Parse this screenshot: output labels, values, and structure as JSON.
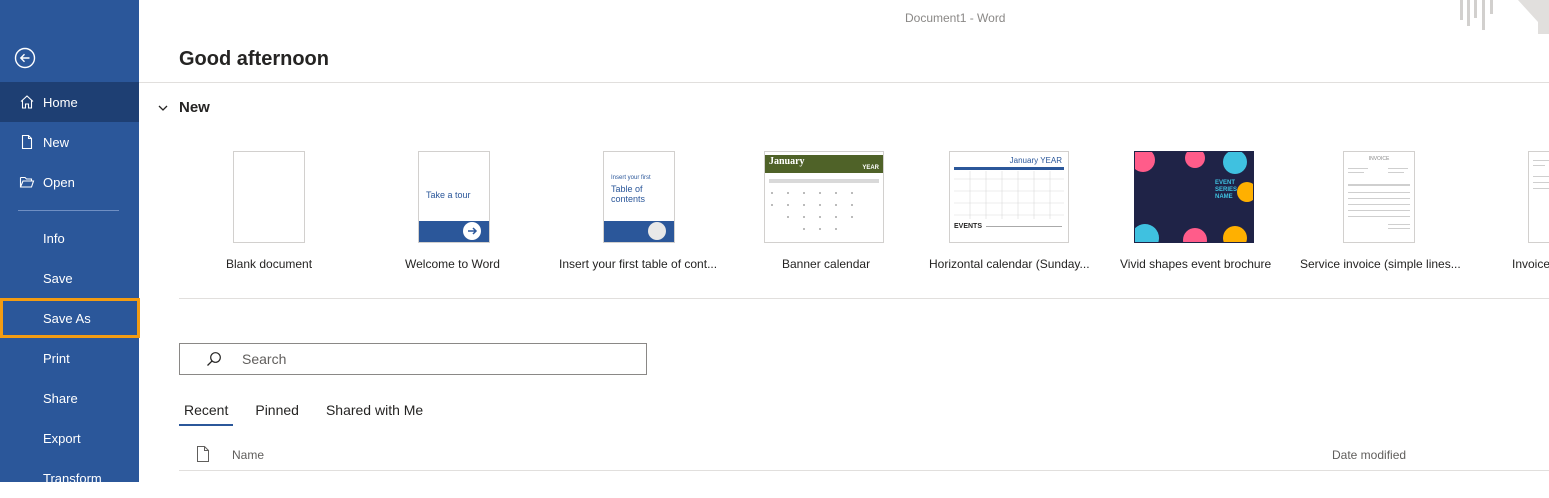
{
  "window": {
    "title": "Document1  -  Word"
  },
  "sidebar": {
    "items": [
      {
        "label": "Home"
      },
      {
        "label": "New"
      },
      {
        "label": "Open"
      },
      {
        "label": "Info"
      },
      {
        "label": "Save"
      },
      {
        "label": "Save As"
      },
      {
        "label": "Print"
      },
      {
        "label": "Share"
      },
      {
        "label": "Export"
      },
      {
        "label": "Transform"
      }
    ],
    "accent": "#2b579a",
    "highlight_color": "#f39c12"
  },
  "main": {
    "greeting": "Good afternoon",
    "new_section": {
      "title": "New"
    },
    "templates": [
      {
        "label": "Blank document"
      },
      {
        "label": "Welcome to Word",
        "thumb_text": "Take a tour"
      },
      {
        "label": "Insert your first table of cont...",
        "thumb_text_1": "Insert your first",
        "thumb_text_2": "Table of contents"
      },
      {
        "label": "Banner calendar",
        "thumb_month": "January",
        "thumb_year": "YEAR"
      },
      {
        "label": "Horizontal calendar (Sunday...",
        "thumb_month": "January",
        "thumb_year": "YEAR",
        "thumb_events": "EVENTS"
      },
      {
        "label": "Vivid shapes event brochure",
        "thumb_text": "EVENT SERIES NAME"
      },
      {
        "label": "Service invoice (simple lines...",
        "thumb_text": "INVOICE"
      },
      {
        "label": "Invoice"
      }
    ],
    "search": {
      "placeholder": "Search"
    },
    "tabs": [
      {
        "label": "Recent",
        "active": true
      },
      {
        "label": "Pinned"
      },
      {
        "label": "Shared with Me"
      }
    ],
    "list": {
      "col_name": "Name",
      "col_date": "Date modified"
    }
  }
}
